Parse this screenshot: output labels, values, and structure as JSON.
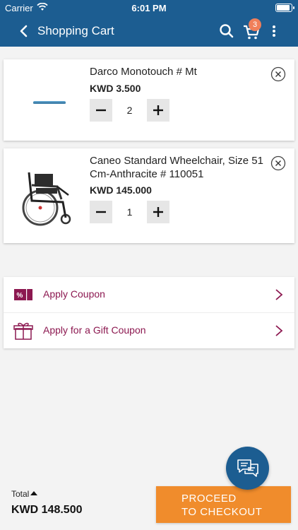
{
  "status_bar": {
    "carrier": "Carrier",
    "time": "6:01 PM"
  },
  "nav": {
    "title": "Shopping Cart",
    "cart_count": "3"
  },
  "cart": {
    "items": [
      {
        "name": "Darco Monotouch # Mt",
        "price": "KWD 3.500",
        "quantity": "2",
        "image": "product-image-monotouch"
      },
      {
        "name": "Caneo Standard Wheelchair, Size 51 Cm-Anthracite # 110051",
        "price": "KWD 145.000",
        "quantity": "1",
        "image": "product-image-wheelchair"
      }
    ]
  },
  "coupons": {
    "apply_coupon": "Apply Coupon",
    "gift_coupon": "Apply for a Gift Coupon"
  },
  "footer": {
    "total_label": "Total",
    "total_value": "KWD 148.500",
    "checkout_line1": "PROCEED",
    "checkout_line2": "TO CHECKOUT"
  },
  "colors": {
    "header": "#1c5d91",
    "badge": "#f07f5a",
    "coupon_text": "#8c1850",
    "checkout": "#f08c2c"
  },
  "icons": [
    "back-arrow-icon",
    "search-icon",
    "cart-icon",
    "more-icon",
    "remove-icon",
    "minus-icon",
    "plus-icon",
    "coupon-icon",
    "gift-icon",
    "chevron-right-icon",
    "chat-icon"
  ]
}
